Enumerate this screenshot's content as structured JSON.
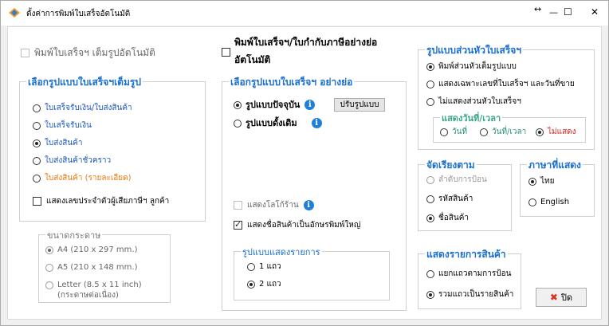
{
  "window": {
    "title": "ตั้งค่าการพิมพ์ใบเสร็จอัตโนมัติ",
    "resize_icon": "↔",
    "minimize": "—",
    "maximize": "☐",
    "close": "✕"
  },
  "auto_full_print": {
    "label": "พิมพ์ใบเสร็จฯ เต็มรูปอัตโนมัติ",
    "checked": false,
    "enabled": false
  },
  "auto_short_print": {
    "label_line1": "พิมพ์ใบเสร็จฯ/ใบกำกับภาษีอย่างย่อ",
    "label_line2": "อัตโนมัติ",
    "checked": false
  },
  "full_format": {
    "title": "เลือกรูปแบบใบเสร็จฯเต็มรูป",
    "options": [
      {
        "label": "ใบเสร็จรับเงิน/ใบส่งสินค้า",
        "selected": false
      },
      {
        "label": "ใบเสร็จรับเงิน",
        "selected": false
      },
      {
        "label": "ใบส่งสินค้า",
        "selected": true
      },
      {
        "label": "ใบส่งสินค้าชั่วคราว",
        "selected": false
      },
      {
        "label": "ใบส่งสินค้า (รายละเอียด)",
        "selected": false
      }
    ],
    "show_taxid": {
      "label": "แสดงเลขประจำตัวผู้เสียภาษีฯ ลูกค้า",
      "checked": false
    }
  },
  "paper_size": {
    "title": "ขนาดกระดาษ",
    "options": [
      {
        "label": "A4 (210 x 297 mm.)",
        "selected": true
      },
      {
        "label": "A5 (210 x 148 mm.)",
        "selected": false
      },
      {
        "label_line1": "Letter (8.5 x 11 inch)",
        "label_line2": "(กระดาษต่อเนื่อง)",
        "selected": false
      }
    ]
  },
  "short_format": {
    "title": "เลือกรูปแบบใบเสร็จฯ อย่างย่อ",
    "options": [
      {
        "label": "รูปแบบปัจจุบัน",
        "selected": true
      },
      {
        "label": "รูปแบบดั้งเดิม",
        "selected": false
      }
    ],
    "adjust_button": "ปรับรูปแบบ",
    "show_logo": {
      "label": "แสดงโลโก้ร้าน",
      "checked": false
    },
    "show_uppercase": {
      "label": "แสดงชื่อสินค้าเป็นอักษรพิมพ์ใหญ่",
      "checked": true
    },
    "info_glyph": "i"
  },
  "list_display": {
    "title": "รูปแบบแสดงรายการ",
    "options": [
      {
        "label": "1 แถว",
        "selected": false
      },
      {
        "label": "2 แถว",
        "selected": true
      }
    ]
  },
  "header_format": {
    "title": "รูปแบบส่วนหัวใบเสร็จฯ",
    "options": [
      {
        "label": "พิมพ์ส่วนหัวเต็มรูปแบบ",
        "selected": true
      },
      {
        "label": "แสดงเฉพาะเลขที่ใบเสร็จฯ และวันที่ขาย",
        "selected": false
      },
      {
        "label": "ไม่แสดงส่วนหัวใบเสร็จฯ",
        "selected": false
      }
    ],
    "datetime": {
      "title": "แสดงวันที่/เวลา",
      "options": [
        {
          "label": "วันที่",
          "selected": false
        },
        {
          "label": "วันที่/เวลา",
          "selected": false
        },
        {
          "label": "ไม่แสดง",
          "selected": true
        }
      ]
    }
  },
  "sort_by": {
    "title": "จัดเรียงตาม",
    "options": [
      {
        "label": "ลำดับการป้อน",
        "selected": false,
        "enabled": false
      },
      {
        "label": "รหัสสินค้า",
        "selected": false
      },
      {
        "label": "ชื่อสินค้า",
        "selected": true
      }
    ]
  },
  "language": {
    "title": "ภาษาที่แสดง",
    "options": [
      {
        "label": "ไทย",
        "selected": true
      },
      {
        "label": "English",
        "selected": false
      }
    ]
  },
  "product_list": {
    "title": "แสดงรายการสินค้า",
    "options": [
      {
        "label": "แยกแถวตามการป้อน",
        "selected": false
      },
      {
        "label": "รวมแถวเป็นรายสินค้า",
        "selected": true
      }
    ]
  },
  "close_button": {
    "icon": "✖",
    "label": "ปิด"
  },
  "colors": {
    "group_title": "#1a6fd0",
    "radio_blue": "#1a55b8",
    "radio_orange": "#e8780c",
    "info_icon": "#1e7fd6",
    "datetime_selected": "#d9261c",
    "close_icon": "#e0301e"
  }
}
